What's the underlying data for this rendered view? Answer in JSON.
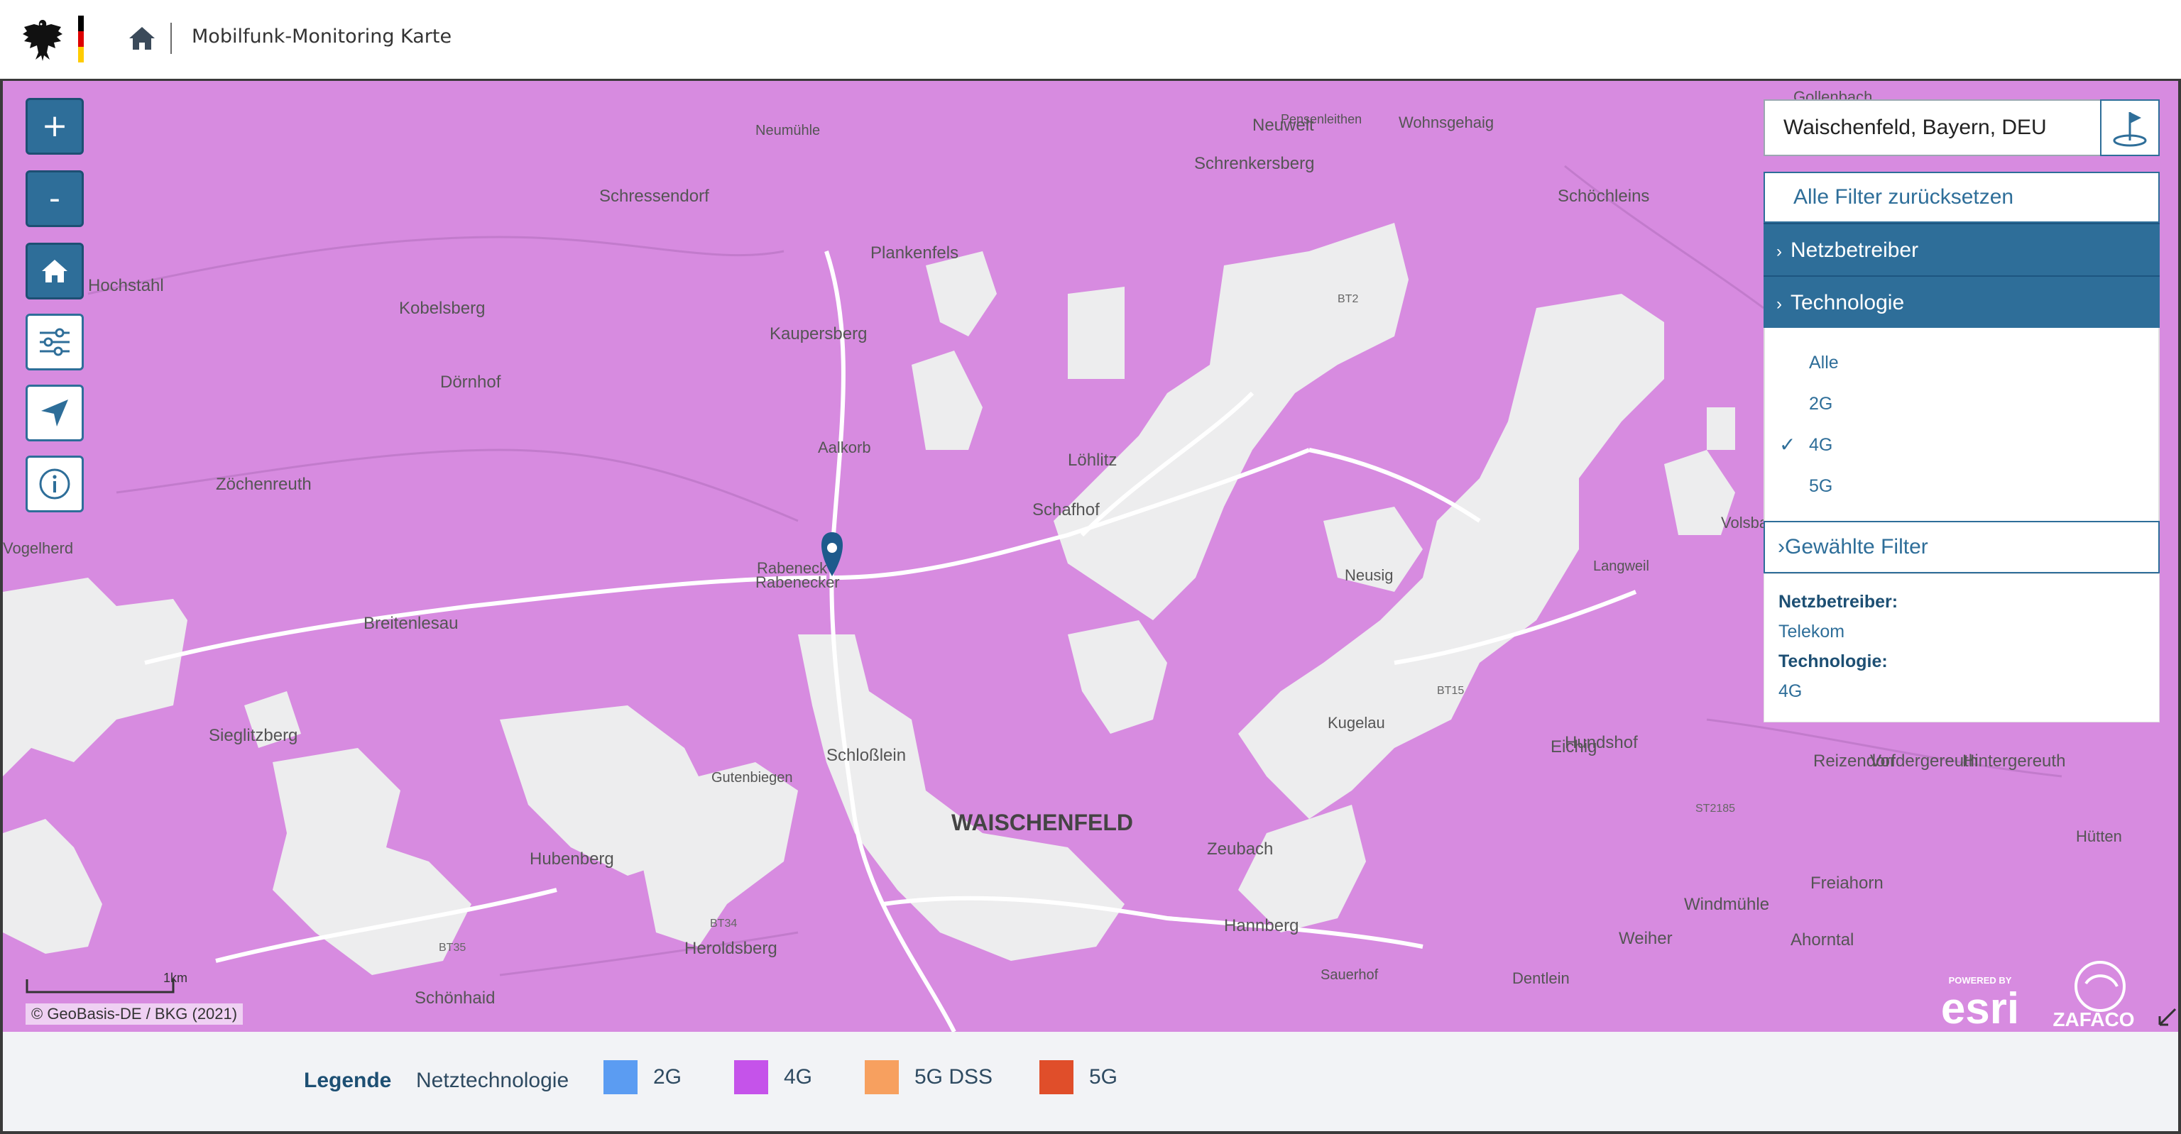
{
  "header": {
    "title": "Mobilfunk-Monitoring Karte",
    "flag_colors": [
      "#000000",
      "#dd0000",
      "#ffcc00"
    ]
  },
  "map": {
    "coverage_color": "#d78be0",
    "background_color": "#ededee",
    "road_color": "#ffffff",
    "place_labels": [
      "Neumühle",
      "Schressendorf",
      "Plankenfels",
      "Hochstahl",
      "Kobelsberg",
      "Kaupersberg",
      "Dörnhof",
      "Aalkorb",
      "Zöchenreuth",
      "Vogelherd",
      "Breitenlesau",
      "Rabenecker",
      "Löhlitz",
      "Schafhof",
      "Neusig",
      "Sieglitzberg",
      "Gutenbiegen",
      "Schloßlein",
      "WAISCHENFELD",
      "Kugelau",
      "Zeubach",
      "Hubenberg",
      "Heroldsberg",
      "Schönhaid",
      "Hannberg",
      "Sauerhof",
      "Dentlein",
      "Neuwelt",
      "Schrenkersberg",
      "Wohnsgehaig",
      "Pensenleithen",
      "Schöchleins",
      "Gollenbach",
      "Volsbach",
      "Langweil",
      "Eichig",
      "Hundshof",
      "Reizendorf",
      "Vordergereuth",
      "Hintergereuth",
      "Hütten",
      "Freiahorn",
      "Windmühle",
      "Weiher",
      "Ahorntal",
      "Rabeneck"
    ],
    "road_labels": [
      "BT2",
      "BT15",
      "BT34",
      "BT35",
      "ST2185"
    ]
  },
  "controls": {
    "zoom_in": "+",
    "zoom_out": "-",
    "home_icon": "home-icon",
    "filter_icon": "sliders-icon",
    "locate_icon": "navigation-arrow-icon",
    "info_icon": "info-icon"
  },
  "search": {
    "value": "Waischenfeld, Bayern, DEU"
  },
  "filters": {
    "reset_label": "Alle Filter zurücksetzen",
    "operator_label": "Netzbetreiber",
    "technology_label": "Technologie",
    "technology_options": [
      {
        "label": "Alle",
        "selected": false
      },
      {
        "label": "2G",
        "selected": false
      },
      {
        "label": "4G",
        "selected": true
      },
      {
        "label": "5G",
        "selected": false
      }
    ],
    "selected_label": "Gewählte Filter",
    "selected": {
      "operator_key": "Netzbetreiber:",
      "operator_value": "Telekom",
      "technology_key": "Technologie:",
      "technology_value": "4G"
    }
  },
  "scale": {
    "label": "1km"
  },
  "attribution": {
    "text": "© GeoBasis-DE / BKG (2021)"
  },
  "logos": {
    "esri_powered": "POWERED BY",
    "esri": "esri",
    "zafaco": "ZAFACO"
  },
  "legend": {
    "title": "Legende",
    "subtitle": "Netztechnologie",
    "items": [
      {
        "label": "2G",
        "color": "#5b9cf2"
      },
      {
        "label": "4G",
        "color": "#c553ea"
      },
      {
        "label": "5G DSS",
        "color": "#f7a05f"
      },
      {
        "label": "5G",
        "color": "#e04e2a"
      }
    ]
  }
}
